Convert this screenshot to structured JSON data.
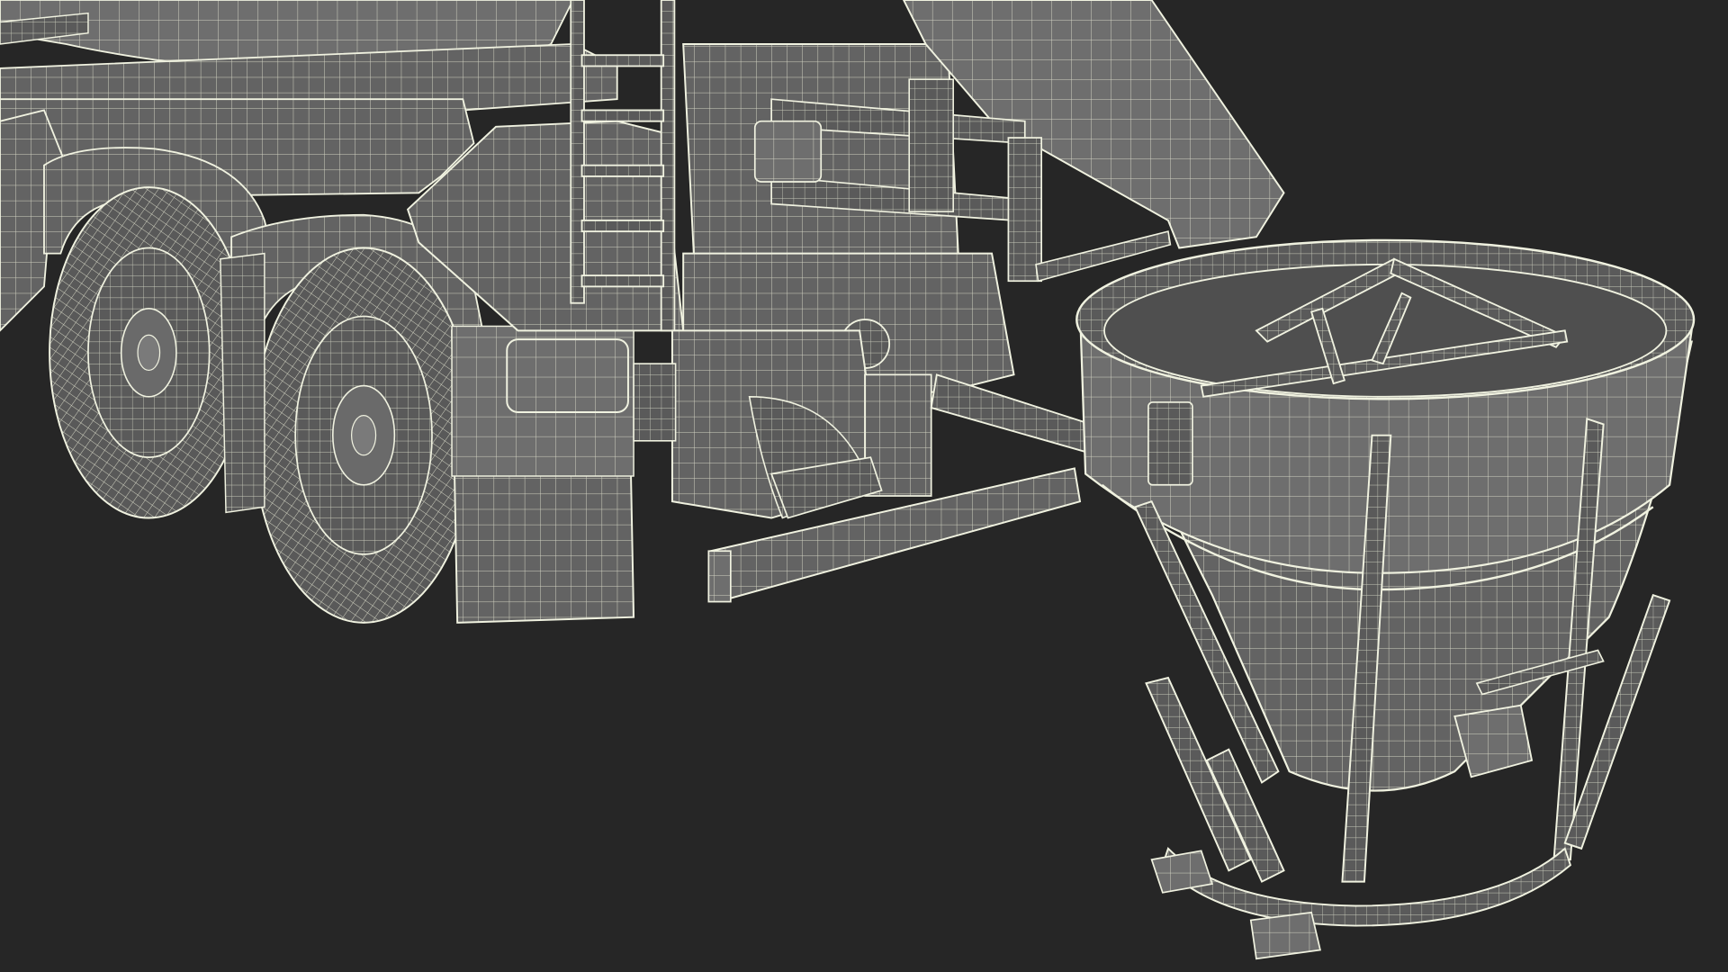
{
  "scene": {
    "subject": "wireframe-render",
    "colors": {
      "background": "#262626",
      "body_fill": "#636363",
      "body_fill_dark": "#4f4f4f",
      "body_fill_light": "#7a7a7a",
      "wire": "#e6e8d4",
      "wire_edge": "#f0f2e0"
    }
  }
}
